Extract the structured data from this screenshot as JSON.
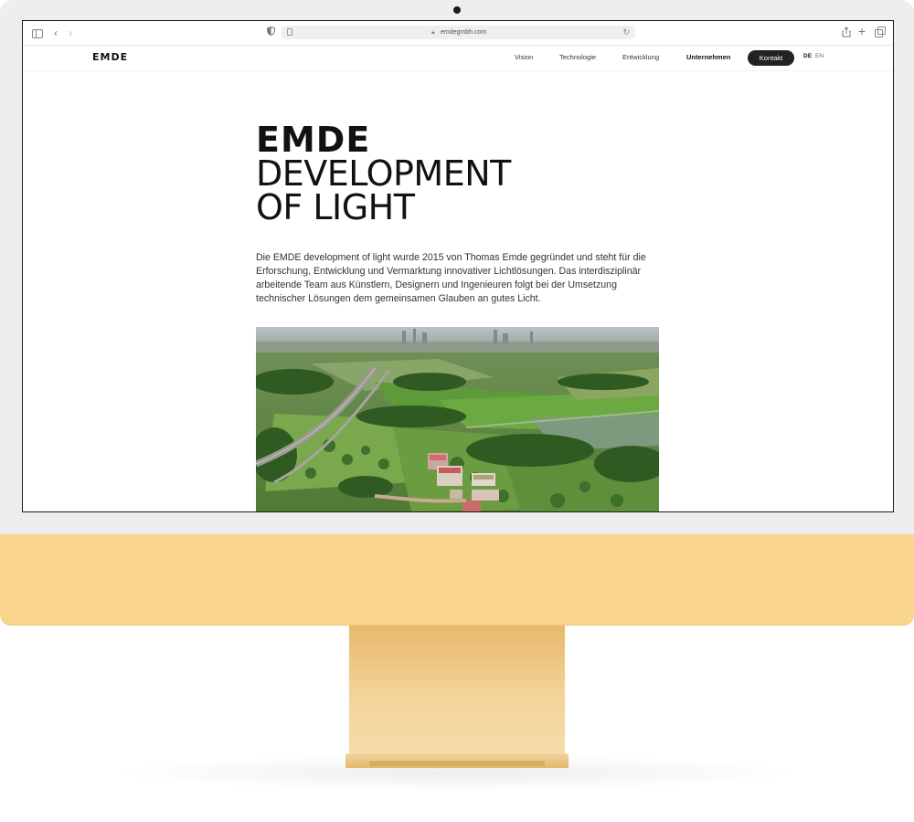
{
  "browser": {
    "url": "emdegmbh.com",
    "icons": [
      "sidebar-icon",
      "back-icon",
      "forward-icon",
      "shield-icon",
      "page-icon",
      "lock-icon",
      "reload-icon",
      "share-icon",
      "new-tab-icon",
      "tabs-icon"
    ]
  },
  "site": {
    "logo": "EMDE",
    "nav": {
      "vision": "Vision",
      "technology": "Technologie",
      "development": "Entwicklung",
      "company": "Unternehmen",
      "contact": "Kontakt"
    },
    "languages": {
      "de": "DE",
      "en": "EN"
    },
    "hero": {
      "line1": "EMDE",
      "line2": "DEVELOPMENT",
      "line3": "OF LIGHT"
    },
    "intro": "Die EMDE development of light wurde 2015 von Thomas Emde gegründet und steht für die Erforschung, Entwicklung und Vermarktung innovativer Lichtlösungen. Das interdisziplinär arbeitende Team aus Künstlern, Designern und Ingenieuren folgt bei der Umsetzung technischer Lösungen dem gemeinsamen Glauben an gutes Licht."
  },
  "colors": {
    "bezel": "#eceef0",
    "chin": "#f9d58d",
    "stand": "#e8b96a",
    "text": "#111111",
    "contact_bg": "#222222"
  }
}
